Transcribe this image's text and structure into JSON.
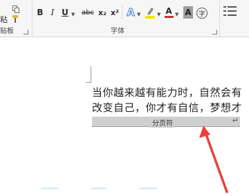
{
  "clipboard": {
    "paste_label": "粘",
    "group_label": "贴板"
  },
  "font_group": {
    "label": "字体",
    "buttons": {
      "bold": "B",
      "italic": "I",
      "underline": "U",
      "strikethrough": "abc",
      "subscript": "x₂",
      "superscript": "x²",
      "text_effects": "A",
      "font_color": "A",
      "char_shading": "A",
      "enclose_char": "字"
    }
  },
  "colors": {
    "highlight": "#f5e50a",
    "font_color": "#d0312d",
    "accent": "#c8102e",
    "arrow": "#e8423a"
  },
  "document": {
    "line1": "当你越来越有能力时，自然会有",
    "line2": "改变自己，你才有自信，梦想才",
    "page_break_label": "分页符",
    "page_break_return": "↵"
  }
}
